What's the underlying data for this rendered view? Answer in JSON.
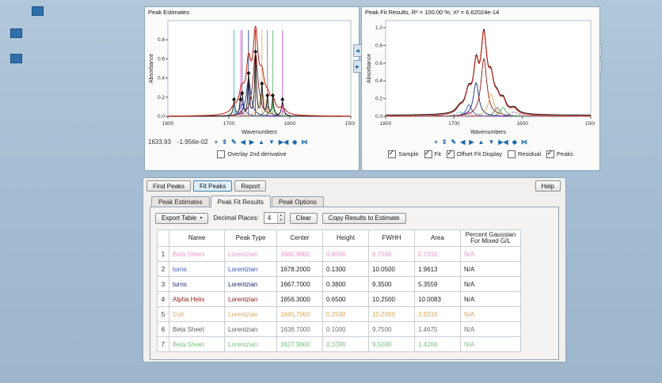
{
  "colors": {
    "accent_blue": "#1a6aad",
    "sample_red": "#c8281c",
    "background": "#a4bcd2"
  },
  "left_panel": {
    "title": "Peak Estimates",
    "readout_x": "1633.93",
    "readout_y": "-1.956e-02",
    "icons": [
      {
        "name": "pan-icon",
        "glyph": "+"
      },
      {
        "name": "zoom-vertical-icon",
        "glyph": "⇕"
      },
      {
        "name": "edit-icon",
        "glyph": "✎"
      },
      {
        "name": "pan-left-icon",
        "glyph": "◀"
      },
      {
        "name": "pan-right-icon",
        "glyph": "▶"
      },
      {
        "name": "pan-up-icon",
        "glyph": "▲"
      },
      {
        "name": "pan-down-icon",
        "glyph": "▼"
      },
      {
        "name": "collapse-icon",
        "glyph": "▶◀"
      },
      {
        "name": "diamond-icon",
        "glyph": "◆"
      },
      {
        "name": "bowtie-icon",
        "glyph": "⋈"
      }
    ],
    "checkbox": {
      "label": "Overlay 2nd derivative",
      "checked": false
    }
  },
  "right_panel": {
    "title": "Peak Fit Results, R² = 100.00 %; X² = 6.62024e-14",
    "icons": [
      {
        "name": "pan-icon",
        "glyph": "+"
      },
      {
        "name": "zoom-vertical-icon",
        "glyph": "⇕"
      },
      {
        "name": "edit-icon",
        "glyph": "✎"
      },
      {
        "name": "pan-left-icon",
        "glyph": "◀"
      },
      {
        "name": "pan-right-icon",
        "glyph": "▶"
      },
      {
        "name": "pan-up-icon",
        "glyph": "▲"
      },
      {
        "name": "pan-down-icon",
        "glyph": "▼"
      },
      {
        "name": "collapse-icon",
        "glyph": "▶◀"
      },
      {
        "name": "diamond-icon",
        "glyph": "◆"
      },
      {
        "name": "bowtie-icon",
        "glyph": "⋈"
      }
    ],
    "checkboxes": [
      {
        "label": "Sample",
        "checked": true
      },
      {
        "label": "Fit",
        "checked": true
      },
      {
        "label": "Offset Fit Display",
        "checked": true
      },
      {
        "label": "Residual",
        "checked": false
      },
      {
        "label": "Peaks",
        "checked": true
      }
    ]
  },
  "actions": {
    "buttons": [
      {
        "label": "Find Peaks",
        "active": false
      },
      {
        "label": "Fit Peaks",
        "active": true
      },
      {
        "label": "Report",
        "active": false
      }
    ],
    "help": "Help"
  },
  "tabs": [
    {
      "label": "Peak Estimates",
      "active": false
    },
    {
      "label": "Peak Fit Results",
      "active": true
    },
    {
      "label": "Peak Options",
      "active": false
    }
  ],
  "results_toolbar": {
    "export": "Export Table",
    "export_caret": "▾",
    "decimal_label": "Decimal Places:",
    "decimal_value": "4",
    "clear": "Clear",
    "copy": "Copy Results to Estimate"
  },
  "results_table": {
    "headers": [
      "Name",
      "Peak Type",
      "Center",
      "Height",
      "FWHH",
      "Area",
      "Percent Gaussian\nFor Mixed G/L"
    ],
    "rows": [
      {
        "num": "1",
        "name": "Beta Sheet",
        "type": "Lorentzian",
        "center": "1680.8000",
        "height": "0.0500",
        "fwhh": "9.7500",
        "area": "0.7315",
        "pg": "N/A",
        "color": "#f294c6",
        "value_color": "#f294c6"
      },
      {
        "num": "2",
        "name": "turns",
        "type": "Lorentzian",
        "center": "1678.2000",
        "height": "0.1300",
        "fwhh": "10.0500",
        "area": "1.9613",
        "pg": "N/A",
        "color": "#3356cc",
        "value_color": "#1c1c1c"
      },
      {
        "num": "3",
        "name": "turns",
        "type": "Lorentzian",
        "center": "1667.7000",
        "height": "0.3800",
        "fwhh": "9.3500",
        "area": "5.3559",
        "pg": "N/A",
        "color": "#1b2a78",
        "value_color": "#1c1c1c"
      },
      {
        "num": "4",
        "name": "Alpha Helix",
        "type": "Lorentzian",
        "center": "1656.3000",
        "height": "0.6500",
        "fwhh": "10.2500",
        "area": "10.0083",
        "pg": "N/A",
        "color": "#8c1a14",
        "value_color": "#1c1c1c"
      },
      {
        "num": "5",
        "name": "Coil",
        "type": "Lorentzian",
        "center": "1645.7000",
        "height": "0.2500",
        "fwhh": "10.2000",
        "area": "3.8316",
        "pg": "N/A",
        "color": "#e2a455",
        "value_color": "#e2a455"
      },
      {
        "num": "6",
        "name": "Beta Sheet",
        "type": "Lorentzian",
        "center": "1636.7000",
        "height": "0.1000",
        "fwhh": "9.7500",
        "area": "1.4675",
        "pg": "N/A",
        "color": "#5f5f5f",
        "value_color": "#6f6f6f"
      },
      {
        "num": "7",
        "name": "Beta Sheet",
        "type": "Lorentzian",
        "center": "1627.9000",
        "height": "0.1000",
        "fwhh": "9.5000",
        "area": "1.4266",
        "pg": "N/A",
        "color": "#74c478",
        "value_color": "#74c478"
      }
    ]
  },
  "chart_data": [
    {
      "id": "peak-estimates-chart",
      "type": "line",
      "title": "Peak Estimates",
      "xlabel": "Wavenumbers",
      "ylabel": "Absorbance",
      "x_range": [
        1800,
        1500
      ],
      "x_ticks": [
        1800,
        1700,
        1600,
        1500
      ],
      "y_ticks": [
        0.0,
        0.2,
        0.4,
        0.6,
        0.8
      ],
      "ylim": [
        0,
        1.0
      ],
      "sample_max": 0.94,
      "sample_color": "#c8281c",
      "show_lines": true,
      "show_components": true,
      "show_derivative": true,
      "show_markers": true,
      "show_fit": false,
      "peaks": [
        {
          "center": 1691.5,
          "height": 0.05,
          "fwhh": 12.0,
          "color": "#23b5c9",
          "dashed": true
        },
        {
          "center": 1680.8,
          "height": 0.05,
          "fwhh": 9.75,
          "color": "#f06ec0"
        },
        {
          "center": 1678.2,
          "height": 0.13,
          "fwhh": 10.05,
          "color": "#3356cc"
        },
        {
          "center": 1667.7,
          "height": 0.38,
          "fwhh": 9.35,
          "color": "#1b2a78"
        },
        {
          "center": 1656.3,
          "height": 0.65,
          "fwhh": 10.25,
          "color": "#8c1a14"
        },
        {
          "center": 1645.7,
          "height": 0.25,
          "fwhh": 10.2,
          "color": "#e2a455"
        },
        {
          "center": 1636.7,
          "height": 0.1,
          "fwhh": 9.75,
          "color": "#6f6f6f"
        },
        {
          "center": 1627.9,
          "height": 0.1,
          "fwhh": 9.5,
          "color": "#52b857"
        },
        {
          "center": 1612.0,
          "height": 0.05,
          "fwhh": 13.0,
          "color": "#c93bd0",
          "dashed": true
        }
      ]
    },
    {
      "id": "peak-fit-results-chart",
      "type": "line",
      "title": "Peak Fit Results",
      "xlabel": "Wavenumbers",
      "ylabel": "Absorbance",
      "x_range": [
        1800,
        1500
      ],
      "x_ticks": [
        1800,
        1700,
        1600,
        1500
      ],
      "y_ticks": [
        0.0,
        0.2,
        0.4,
        0.6,
        0.8,
        1.0
      ],
      "ylim": [
        0,
        1.08
      ],
      "sample_max": 0.97,
      "sample_color": "#c8281c",
      "show_lines": false,
      "show_components": true,
      "show_derivative": false,
      "show_markers": false,
      "show_fit": true,
      "peaks": [
        {
          "center": 1691.5,
          "height": 0.05,
          "fwhh": 12.0,
          "color": "#23b5c9",
          "dashed": true
        },
        {
          "center": 1680.8,
          "height": 0.05,
          "fwhh": 9.75,
          "color": "#f06ec0"
        },
        {
          "center": 1678.2,
          "height": 0.13,
          "fwhh": 10.05,
          "color": "#3356cc"
        },
        {
          "center": 1667.7,
          "height": 0.38,
          "fwhh": 9.35,
          "color": "#1b2a78"
        },
        {
          "center": 1656.3,
          "height": 0.65,
          "fwhh": 10.25,
          "color": "#8c1a14"
        },
        {
          "center": 1645.7,
          "height": 0.25,
          "fwhh": 10.2,
          "color": "#e2a455"
        },
        {
          "center": 1636.7,
          "height": 0.1,
          "fwhh": 9.75,
          "color": "#6f6f6f"
        },
        {
          "center": 1627.9,
          "height": 0.1,
          "fwhh": 9.5,
          "color": "#52b857"
        },
        {
          "center": 1612.0,
          "height": 0.05,
          "fwhh": 13.0,
          "color": "#c93bd0",
          "dashed": true
        }
      ]
    }
  ]
}
